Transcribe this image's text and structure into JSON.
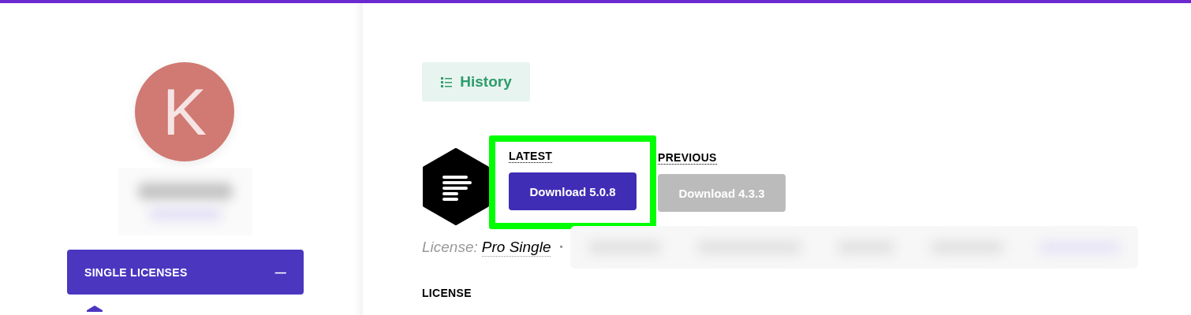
{
  "sidebar": {
    "avatar": {
      "initial": "K"
    },
    "section": {
      "label": "SINGLE LICENSES",
      "toggle": "—",
      "expanded": true
    }
  },
  "history_button": {
    "label": "History"
  },
  "releases": [
    {
      "heading": "LATEST",
      "button": "Download 5.0.8",
      "kind": "primary",
      "highlighted": true
    },
    {
      "heading": "PREVIOUS",
      "button": "Download 4.3.3",
      "kind": "secondary",
      "highlighted": false
    }
  ],
  "license": {
    "label": "License:",
    "value": "Pro Single",
    "separator": "•"
  },
  "license_heading": "LICENSE"
}
